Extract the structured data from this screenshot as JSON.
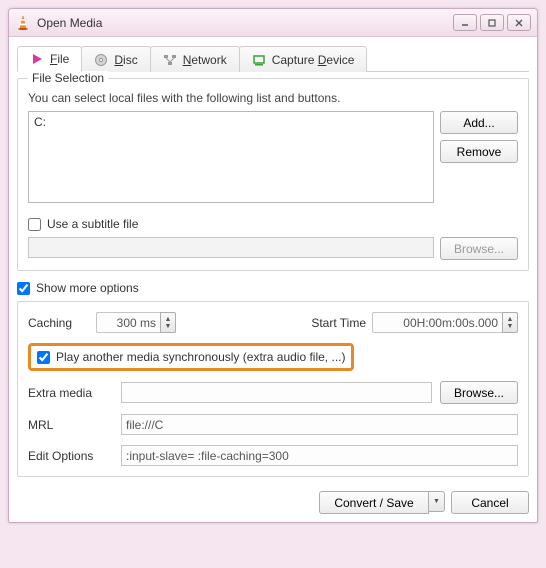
{
  "window": {
    "title": "Open Media"
  },
  "tabs": {
    "file": "File",
    "disc": "Disc",
    "network": "Network",
    "capture": "Capture Device"
  },
  "fileSelection": {
    "legend": "File Selection",
    "help": "You can select local files with the following list and buttons.",
    "entry": "C:",
    "addBtn": "Add...",
    "removeBtn": "Remove"
  },
  "subtitle": {
    "checkboxLabel": "Use a subtitle file",
    "checked": false,
    "path": "",
    "browse": "Browse..."
  },
  "showMore": {
    "label": "Show more options",
    "checked": true
  },
  "options": {
    "cachingLabel": "Caching",
    "cachingValue": "300 ms",
    "startTimeLabel": "Start Time",
    "startTimeValue": "00H:00m:00s.000",
    "playSync": {
      "label": "Play another media synchronously (extra audio file, ...)",
      "checked": true
    },
    "extraMedia": {
      "label": "Extra media",
      "value": "",
      "browse": "Browse..."
    },
    "mrl": {
      "label": "MRL",
      "value": "file:///C"
    },
    "editOptions": {
      "label": "Edit Options",
      "value": ":input-slave= :file-caching=300"
    }
  },
  "footer": {
    "convert": "Convert / Save",
    "cancel": "Cancel"
  }
}
